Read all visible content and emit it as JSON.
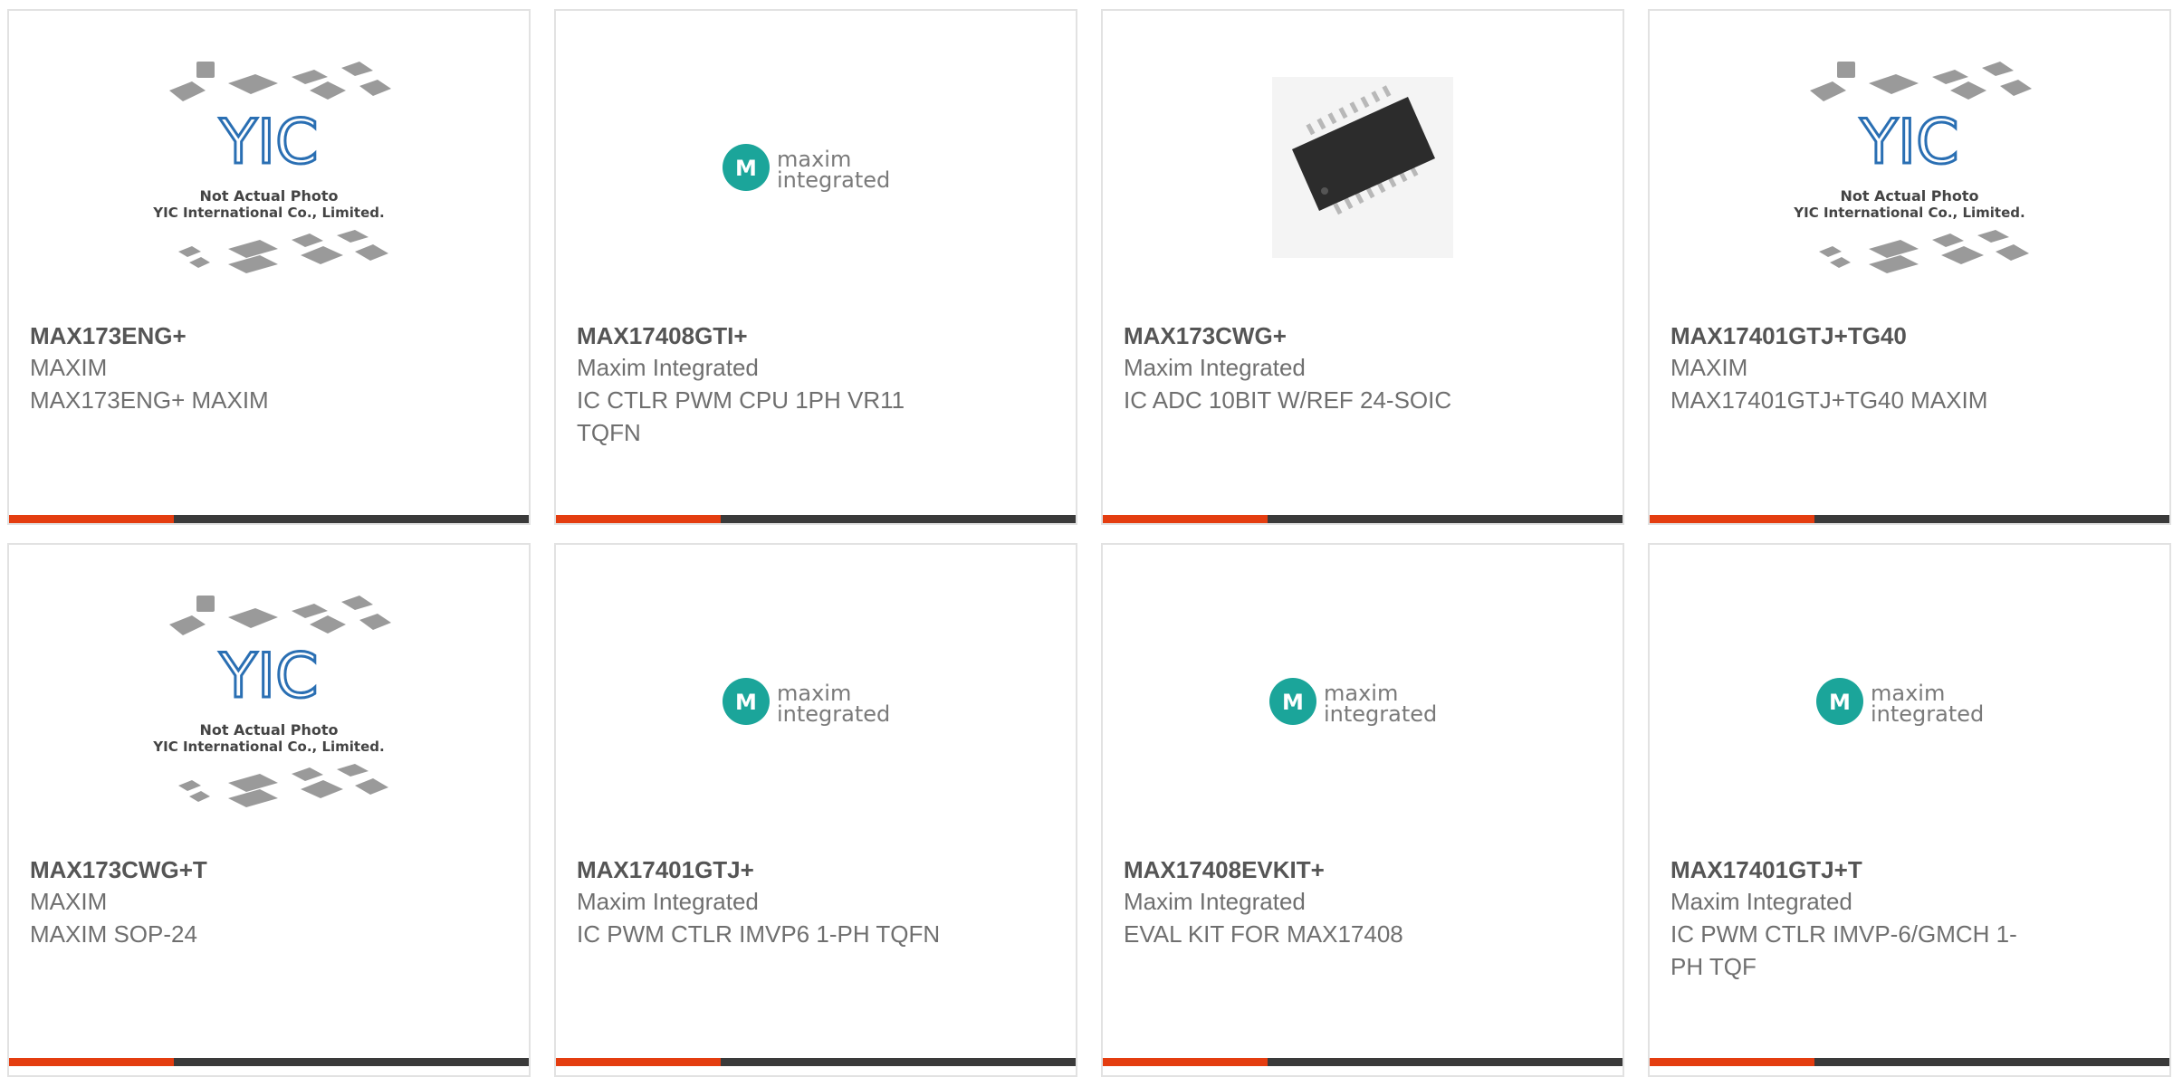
{
  "products": [
    {
      "part": "MAX173ENG+",
      "manufacturer": "MAXIM",
      "description": "MAX173ENG+ MAXIM",
      "image": "yic-placeholder",
      "image_text": {
        "line1": "Not Actual Photo",
        "line2": "YIC International Co., Limited."
      }
    },
    {
      "part": "MAX17408GTI+",
      "manufacturer": "Maxim Integrated",
      "description": "IC CTLR PWM CPU 1PH VR11 TQFN",
      "image": "maxim-logo",
      "image_text": {
        "line1": "maxim",
        "line2": "integrated"
      }
    },
    {
      "part": "MAX173CWG+",
      "manufacturer": "Maxim Integrated",
      "description": "IC ADC 10BIT W/REF 24-SOIC",
      "image": "soic-chip-photo"
    },
    {
      "part": "MAX17401GTJ+TG40",
      "manufacturer": "MAXIM",
      "description": "MAX17401GTJ+TG40 MAXIM",
      "image": "yic-placeholder",
      "image_text": {
        "line1": "Not Actual Photo",
        "line2": "YIC International Co., Limited."
      }
    },
    {
      "part": "MAX173CWG+T",
      "manufacturer": "MAXIM",
      "description": "MAXIM SOP-24",
      "image": "yic-placeholder",
      "image_text": {
        "line1": "Not Actual Photo",
        "line2": "YIC International Co., Limited."
      }
    },
    {
      "part": "MAX17401GTJ+",
      "manufacturer": "Maxim Integrated",
      "description": "IC PWM CTLR IMVP6 1-PH TQFN",
      "image": "maxim-logo",
      "image_text": {
        "line1": "maxim",
        "line2": "integrated"
      }
    },
    {
      "part": "MAX17408EVKIT+",
      "manufacturer": "Maxim Integrated",
      "description": "EVAL KIT FOR MAX17408",
      "image": "maxim-logo",
      "image_text": {
        "line1": "maxim",
        "line2": "integrated"
      }
    },
    {
      "part": "MAX17401GTJ+T",
      "manufacturer": "Maxim Integrated",
      "description": "IC PWM CTLR IMVP-6/GMCH 1-PH TQF",
      "image": "maxim-logo",
      "image_text": {
        "line1": "maxim",
        "line2": "integrated"
      }
    }
  ],
  "colors": {
    "accent": "#e43d10",
    "bar": "#3a3a3a",
    "maxim_teal": "#1ba59a",
    "yic_blue": "#2a6fb3"
  }
}
